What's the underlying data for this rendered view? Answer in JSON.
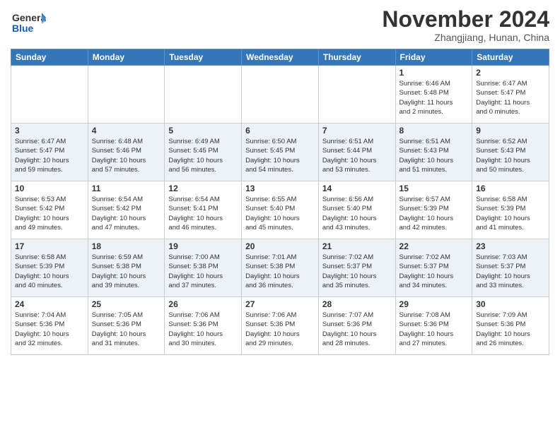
{
  "header": {
    "logo_general": "General",
    "logo_blue": "Blue",
    "month_title": "November 2024",
    "subtitle": "Zhangjiang, Hunan, China"
  },
  "weekdays": [
    "Sunday",
    "Monday",
    "Tuesday",
    "Wednesday",
    "Thursday",
    "Friday",
    "Saturday"
  ],
  "weeks": [
    [
      {
        "day": "",
        "info": ""
      },
      {
        "day": "",
        "info": ""
      },
      {
        "day": "",
        "info": ""
      },
      {
        "day": "",
        "info": ""
      },
      {
        "day": "",
        "info": ""
      },
      {
        "day": "1",
        "info": "Sunrise: 6:46 AM\nSunset: 5:48 PM\nDaylight: 11 hours\nand 2 minutes."
      },
      {
        "day": "2",
        "info": "Sunrise: 6:47 AM\nSunset: 5:47 PM\nDaylight: 11 hours\nand 0 minutes."
      }
    ],
    [
      {
        "day": "3",
        "info": "Sunrise: 6:47 AM\nSunset: 5:47 PM\nDaylight: 10 hours\nand 59 minutes."
      },
      {
        "day": "4",
        "info": "Sunrise: 6:48 AM\nSunset: 5:46 PM\nDaylight: 10 hours\nand 57 minutes."
      },
      {
        "day": "5",
        "info": "Sunrise: 6:49 AM\nSunset: 5:45 PM\nDaylight: 10 hours\nand 56 minutes."
      },
      {
        "day": "6",
        "info": "Sunrise: 6:50 AM\nSunset: 5:45 PM\nDaylight: 10 hours\nand 54 minutes."
      },
      {
        "day": "7",
        "info": "Sunrise: 6:51 AM\nSunset: 5:44 PM\nDaylight: 10 hours\nand 53 minutes."
      },
      {
        "day": "8",
        "info": "Sunrise: 6:51 AM\nSunset: 5:43 PM\nDaylight: 10 hours\nand 51 minutes."
      },
      {
        "day": "9",
        "info": "Sunrise: 6:52 AM\nSunset: 5:43 PM\nDaylight: 10 hours\nand 50 minutes."
      }
    ],
    [
      {
        "day": "10",
        "info": "Sunrise: 6:53 AM\nSunset: 5:42 PM\nDaylight: 10 hours\nand 49 minutes."
      },
      {
        "day": "11",
        "info": "Sunrise: 6:54 AM\nSunset: 5:42 PM\nDaylight: 10 hours\nand 47 minutes."
      },
      {
        "day": "12",
        "info": "Sunrise: 6:54 AM\nSunset: 5:41 PM\nDaylight: 10 hours\nand 46 minutes."
      },
      {
        "day": "13",
        "info": "Sunrise: 6:55 AM\nSunset: 5:40 PM\nDaylight: 10 hours\nand 45 minutes."
      },
      {
        "day": "14",
        "info": "Sunrise: 6:56 AM\nSunset: 5:40 PM\nDaylight: 10 hours\nand 43 minutes."
      },
      {
        "day": "15",
        "info": "Sunrise: 6:57 AM\nSunset: 5:39 PM\nDaylight: 10 hours\nand 42 minutes."
      },
      {
        "day": "16",
        "info": "Sunrise: 6:58 AM\nSunset: 5:39 PM\nDaylight: 10 hours\nand 41 minutes."
      }
    ],
    [
      {
        "day": "17",
        "info": "Sunrise: 6:58 AM\nSunset: 5:39 PM\nDaylight: 10 hours\nand 40 minutes."
      },
      {
        "day": "18",
        "info": "Sunrise: 6:59 AM\nSunset: 5:38 PM\nDaylight: 10 hours\nand 39 minutes."
      },
      {
        "day": "19",
        "info": "Sunrise: 7:00 AM\nSunset: 5:38 PM\nDaylight: 10 hours\nand 37 minutes."
      },
      {
        "day": "20",
        "info": "Sunrise: 7:01 AM\nSunset: 5:38 PM\nDaylight: 10 hours\nand 36 minutes."
      },
      {
        "day": "21",
        "info": "Sunrise: 7:02 AM\nSunset: 5:37 PM\nDaylight: 10 hours\nand 35 minutes."
      },
      {
        "day": "22",
        "info": "Sunrise: 7:02 AM\nSunset: 5:37 PM\nDaylight: 10 hours\nand 34 minutes."
      },
      {
        "day": "23",
        "info": "Sunrise: 7:03 AM\nSunset: 5:37 PM\nDaylight: 10 hours\nand 33 minutes."
      }
    ],
    [
      {
        "day": "24",
        "info": "Sunrise: 7:04 AM\nSunset: 5:36 PM\nDaylight: 10 hours\nand 32 minutes."
      },
      {
        "day": "25",
        "info": "Sunrise: 7:05 AM\nSunset: 5:36 PM\nDaylight: 10 hours\nand 31 minutes."
      },
      {
        "day": "26",
        "info": "Sunrise: 7:06 AM\nSunset: 5:36 PM\nDaylight: 10 hours\nand 30 minutes."
      },
      {
        "day": "27",
        "info": "Sunrise: 7:06 AM\nSunset: 5:36 PM\nDaylight: 10 hours\nand 29 minutes."
      },
      {
        "day": "28",
        "info": "Sunrise: 7:07 AM\nSunset: 5:36 PM\nDaylight: 10 hours\nand 28 minutes."
      },
      {
        "day": "29",
        "info": "Sunrise: 7:08 AM\nSunset: 5:36 PM\nDaylight: 10 hours\nand 27 minutes."
      },
      {
        "day": "30",
        "info": "Sunrise: 7:09 AM\nSunset: 5:36 PM\nDaylight: 10 hours\nand 26 minutes."
      }
    ]
  ]
}
